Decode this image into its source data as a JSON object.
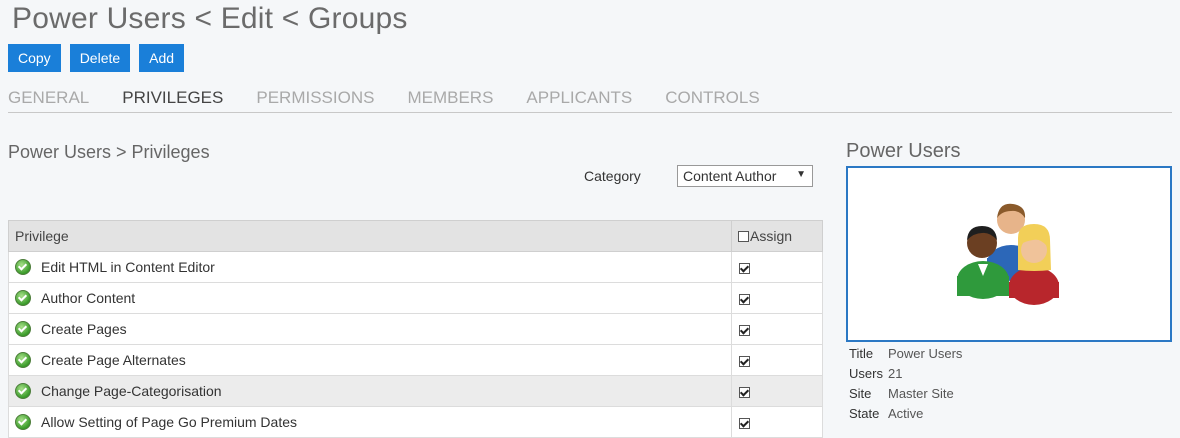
{
  "page": {
    "title": "Power Users < Edit < Groups"
  },
  "actions": {
    "copy": "Copy",
    "delete": "Delete",
    "add": "Add"
  },
  "tabs": [
    {
      "label": "GENERAL",
      "active": false
    },
    {
      "label": "PRIVILEGES",
      "active": true
    },
    {
      "label": "PERMISSIONS",
      "active": false
    },
    {
      "label": "MEMBERS",
      "active": false
    },
    {
      "label": "APPLICANTS",
      "active": false
    },
    {
      "label": "CONTROLS",
      "active": false
    }
  ],
  "privileges": {
    "breadcrumb": "Power Users > Privileges",
    "category_label": "Category",
    "category_value": "Content Author",
    "table": {
      "col_privilege": "Privilege",
      "col_assign": "Assign",
      "rows": [
        {
          "name": "Edit HTML in Content Editor",
          "assigned": true
        },
        {
          "name": "Author Content",
          "assigned": true
        },
        {
          "name": "Create Pages",
          "assigned": true
        },
        {
          "name": "Create Page Alternates",
          "assigned": true
        },
        {
          "name": "Change Page-Categorisation",
          "assigned": true
        },
        {
          "name": "Allow Setting of Page Go Premium Dates",
          "assigned": true
        }
      ]
    }
  },
  "group": {
    "heading": "Power Users",
    "icon": "users-group-icon",
    "info": {
      "title_label": "Title",
      "title_value": "Power Users",
      "users_label": "Users",
      "users_value": "21",
      "site_label": "Site",
      "site_value": "Master Site",
      "state_label": "State",
      "state_value": "Active"
    }
  },
  "colors": {
    "accent": "#1a7fd9",
    "box_border": "#2b78c4"
  }
}
